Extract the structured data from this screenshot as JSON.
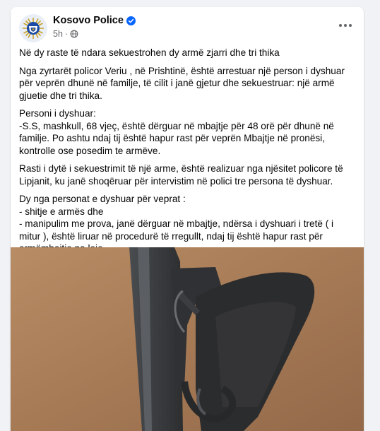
{
  "post": {
    "author": "Kosovo Police",
    "time": "5h",
    "separator": "·",
    "icons": {
      "verified": "verified-badge-icon",
      "audience": "globe-icon",
      "more": "more-options-icon",
      "avatar": "police-emblem-icon"
    },
    "paragraphs": [
      "Në dy raste të ndara  sekuestrohen dy armë zjarri dhe tri thika",
      "Nga zyrtarët policor Veriu , në Prishtinë, është arrestuar një person i dyshuar për veprën dhunë në familje, të cilit  i janë gjetur dhe sekuestruar: një armë gjuetie dhe tri thika.",
      "Personi i dyshuar:\n-S.S, mashkull,  68 vjeç,  është dërguar në mbajtje për 48 orë për dhunë në familje. Po ashtu ndaj tij është hapur rast për veprën Mbajtje në pronësi, kontrolle ose posedim te armëve.",
      "Rasti i dytë i sekuestrimit të një arme, është realizuar nga njësitet policore të Lipjanit, ku janë shoqëruar për intervistim në polici tre persona të dyshuar.",
      "Dy nga personat e dyshuar për veprat :\n- shitje e armës dhe\n- manipulim me prova,  janë dërguar në mbajtje, ndërsa i dyshuari i tretë ( i mitur ), është liruar në procedurë të rregullt, ndaj tij është hapur rast për armëmbajtje pa leje."
    ],
    "photo_subject": "pistol-photo"
  },
  "colors": {
    "background": "#f0f2f5",
    "card": "#ffffff",
    "text": "#050505",
    "secondary": "#65676b",
    "verified": "#0866ff"
  }
}
